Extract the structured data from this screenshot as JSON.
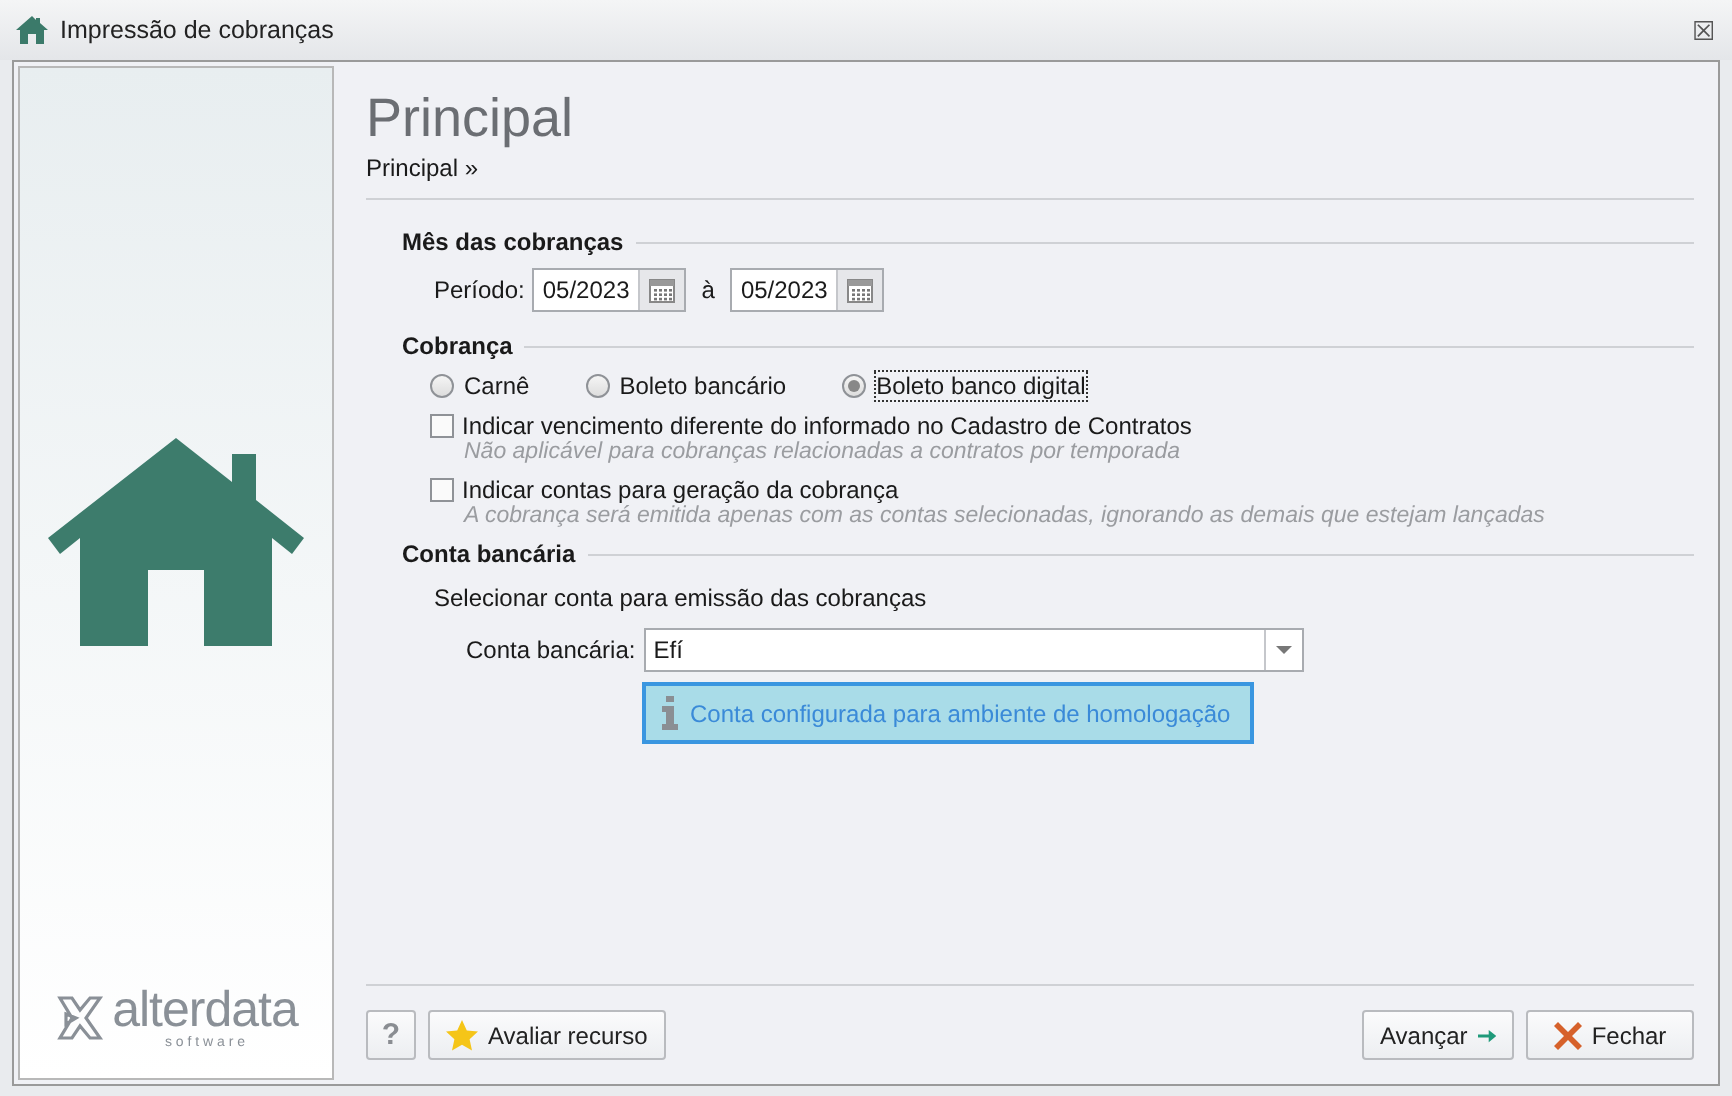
{
  "window": {
    "title": "Impressão de cobranças",
    "close": "☒"
  },
  "header": {
    "title": "Principal",
    "breadcrumb": "Principal »"
  },
  "logo": {
    "name": "alterdata",
    "tagline": "s o f t w a r e"
  },
  "sections": [
    {
      "kind": "period",
      "title": "Mês das cobranças",
      "label": "Período:",
      "from": "05/2023",
      "separator": "à",
      "to": "05/2023"
    },
    {
      "kind": "billing",
      "title": "Cobrança",
      "options": [
        {
          "label": "Carnê",
          "selected": false
        },
        {
          "label": "Boleto bancário",
          "selected": false
        },
        {
          "label": "Boleto banco digital",
          "selected": true
        }
      ],
      "checks": [
        {
          "label": "Indicar vencimento diferente do informado no Cadastro de Contratos",
          "hint": "Não aplicável para cobranças relacionadas a contratos por temporada",
          "checked": false
        },
        {
          "label": "Indicar contas para geração da cobrança",
          "hint": "A cobrança será emitida apenas com as contas selecionadas, ignorando as demais que estejam lançadas",
          "checked": false
        }
      ]
    },
    {
      "kind": "account",
      "title": "Conta bancária",
      "description": "Selecionar conta para emissão das cobranças",
      "label": "Conta bancária:",
      "value": "Efí",
      "info": "Conta configurada para ambiente de homologação"
    }
  ],
  "footer": {
    "help": "?",
    "rate": "Avaliar recurso",
    "next": "Avançar",
    "close": "Fechar"
  }
}
